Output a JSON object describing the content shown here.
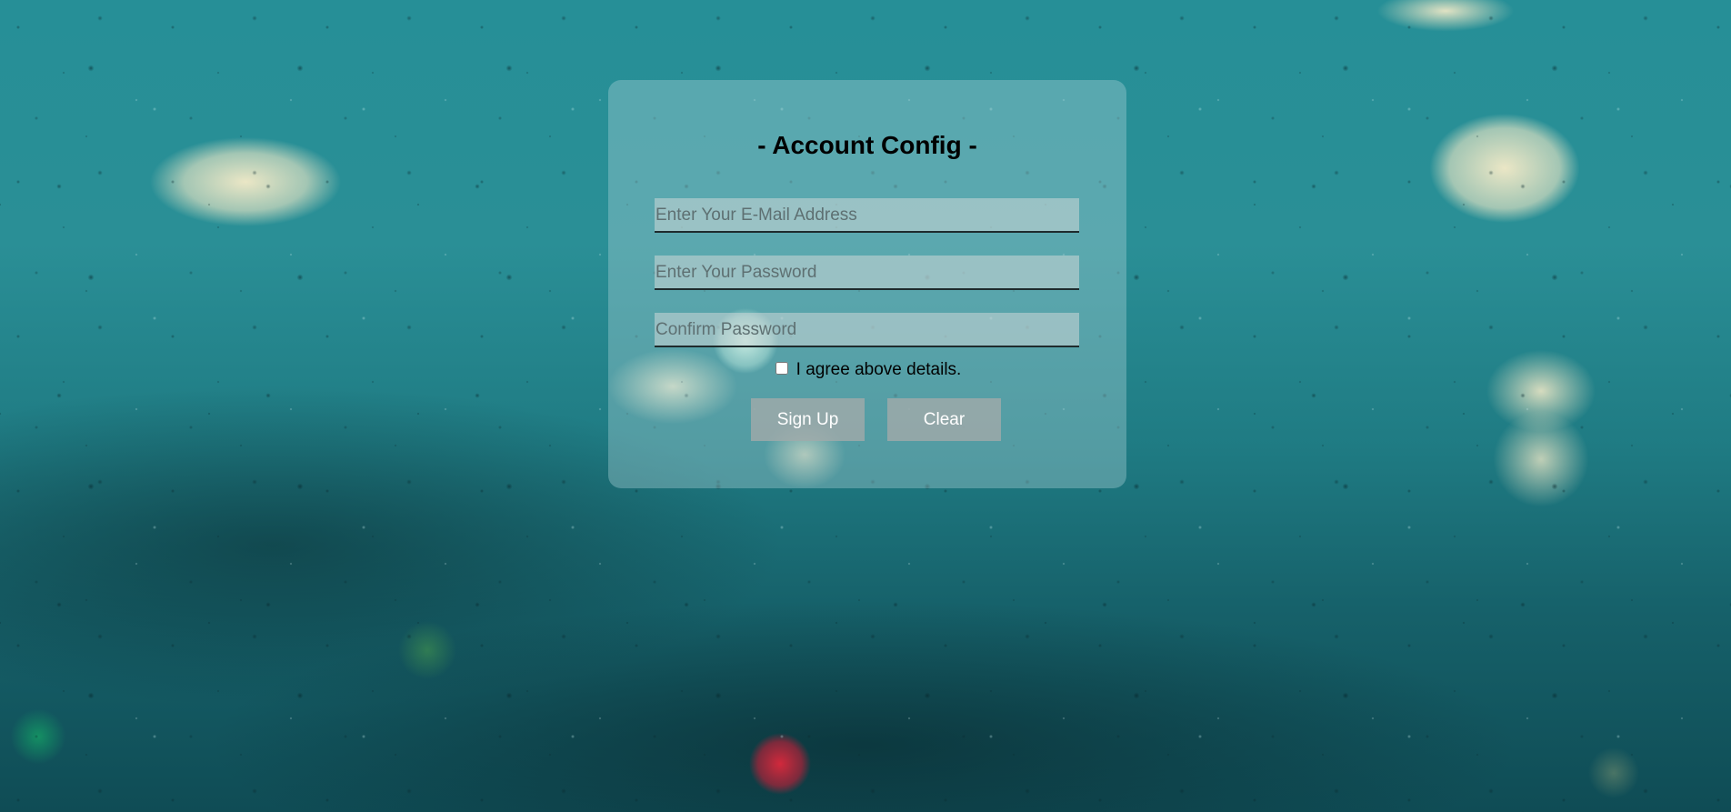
{
  "form": {
    "title": "- Account Config -",
    "email_placeholder": "Enter Your E-Mail Address",
    "password_placeholder": "Enter Your Password",
    "confirm_placeholder": "Confirm Password",
    "agree_label": "I agree above details.",
    "agree_checked": false,
    "signup_label": "Sign Up",
    "clear_label": "Clear"
  }
}
